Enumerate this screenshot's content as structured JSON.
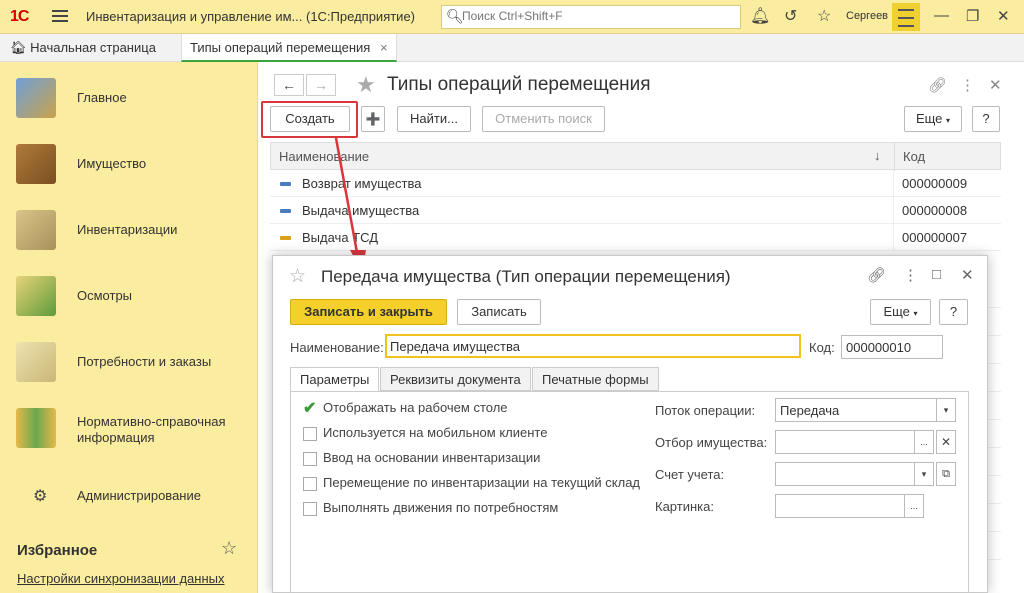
{
  "window": {
    "logo": "1С",
    "title": "Инвентаризация и управление им...  (1С:Предприятие)",
    "search_placeholder": "Поиск Ctrl+Shift+F",
    "user": "Сергеев"
  },
  "tabs": {
    "home": "Начальная страница",
    "active": "Типы операций перемещения",
    "close": "×"
  },
  "sidebar": {
    "items": [
      {
        "label": "Главное"
      },
      {
        "label": "Имущество"
      },
      {
        "label": "Инвентаризации"
      },
      {
        "label": "Осмотры"
      },
      {
        "label": "Потребности и заказы"
      },
      {
        "label": "Нормативно-справочная информация"
      },
      {
        "label": "Администрирование"
      }
    ],
    "favorites_title": "Избранное",
    "favorites_link": "Настройки синхронизации данных"
  },
  "list_form": {
    "title": "Типы операций перемещения",
    "create": "Создать",
    "find": "Найти...",
    "cancel_search": "Отменить поиск",
    "more": "Еще",
    "help": "?",
    "columns": {
      "name": "Наименование",
      "code": "Код"
    },
    "rows": [
      {
        "name": "Возврат имущества",
        "code": "000000009"
      },
      {
        "name": "Выдача имущества",
        "code": "000000008"
      },
      {
        "name": "Выдача ТСД",
        "code": "000000007"
      }
    ]
  },
  "dialog": {
    "title": "Передача имущества (Тип операции перемещения)",
    "save_close": "Записать и закрыть",
    "save": "Записать",
    "more": "Еще",
    "help": "?",
    "name_label": "Наименование:",
    "name_value": "Передача имущества",
    "code_label": "Код:",
    "code_value": "000000010",
    "tabs": [
      "Параметры",
      "Реквизиты документа",
      "Печатные формы"
    ],
    "checkboxes": [
      {
        "label": "Отображать на рабочем столе",
        "checked": true
      },
      {
        "label": "Используется на мобильном клиенте",
        "checked": false
      },
      {
        "label": "Ввод на основании инвентаризации",
        "checked": false
      },
      {
        "label": "Перемещение по инвентаризации на текущий склад",
        "checked": false
      },
      {
        "label": "Выполнять движения по потребностям",
        "checked": false
      }
    ],
    "fields": {
      "flow_label": "Поток операции:",
      "flow_value": "Передача",
      "filter_label": "Отбор имущества:",
      "filter_value": "",
      "account_label": "Счет учета:",
      "account_value": "",
      "picture_label": "Картинка:",
      "picture_value": ""
    }
  },
  "colors": {
    "accent_yellow": "#f5d02a",
    "panel_yellow": "#fbeda0",
    "highlight_red": "#d9363e",
    "check_green": "#3a9a3a"
  }
}
